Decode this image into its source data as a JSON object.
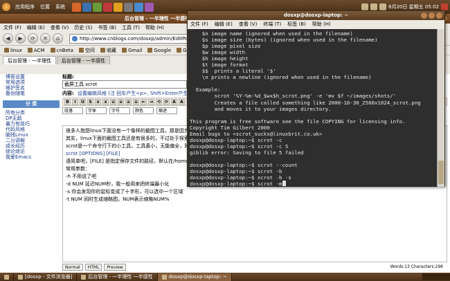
{
  "top_panel": {
    "menu": [
      "应用程序",
      "位置",
      "系统"
    ],
    "clock": "8月20日 星期五 05:02"
  },
  "browser": {
    "title": "后台管理 - 一半理性 一半感性 - 博客园 - Mozilla Firefox",
    "menu": [
      "文件 (F)",
      "编辑 (E)",
      "查看 (V)",
      "历史 (S)",
      "书签 (B)",
      "工具 (T)",
      "帮助 (H)"
    ],
    "url": "http://www.cnblogs.com/dosxp/admin/EditPosts.a",
    "bookmarks": [
      "linux",
      "ACM",
      "cnBeta",
      "空间",
      "收藏",
      "Gmail",
      "Google",
      "GoogleM"
    ],
    "tabs": [
      "后台管理 - 一半理性",
      "后台管理 - 一半感性"
    ],
    "status": "完成"
  },
  "left_col": {
    "top_links": [
      "博客设置",
      "常用选项",
      "维护签名",
      "备份随笔"
    ],
    "category_header": "分 类",
    "links": [
      "所有分类",
      "DP无敌",
      "暴力有技巧",
      "代码风格",
      "脑残Linux",
      "二分讲解",
      "成长经历",
      "综论综论",
      "我爱Emacs"
    ]
  },
  "editor": {
    "title_label": "标题:",
    "title_value": "截屏工具 scrot",
    "content_label": "内容:",
    "content_tools": "设置编辑风格 (注 回车产生<p>, Shift+Enter产生<br>)",
    "toolbar": [
      "B",
      "I",
      "U",
      "S",
      "x",
      "x",
      "≡",
      "≡",
      "≡",
      "≡",
      "⇤",
      "⇥",
      "⟲",
      "⟳",
      "A",
      "A"
    ],
    "selects": [
      "段落",
      "字体",
      "字号",
      "颜色",
      "缩进"
    ],
    "lines": [
      "很多人抱怨linux下面没有一个像样的截图工具，那是因为你没有发现。",
      "其实，linux下面的截图工具还是有很多的，不过处于探索中。",
      "scrot是一个命令行下的小工具，工具虽小，无能偏全，简单实用。",
      "scrot [OPTIONS] [FILE]",
      "语简单吧，[FILE] 是指定保存文件的路径，默认在/home目录下。",
      "常用参数：",
      "-h          不用说了吧",
      "-d NUM      延迟NUM秒，我一般用来把终端最小化",
      "-s          你会发现你的鼠标变成了十字形，可以选中一个区域",
      "-t NUM      同时生成缩略图，NUM表示缩略NUM%"
    ],
    "footer_modes": [
      "Normal",
      "HTML",
      "Preview"
    ],
    "word_count": "Words:13 Characters:296"
  },
  "terminal": {
    "title": "dosxp@dosxp-laptop: ~",
    "menu": [
      "文件 (F)",
      "编辑 (E)",
      "查看 (V)",
      "终端 (T)",
      "标签 (B)",
      "帮助 (H)"
    ],
    "text": "    $n image name (ignored when used in the filename)\n    $s image size (bytes) (ignored when used in the filename)\n    $p image pixel size\n    $w image width\n    $h image height\n    $t image format\n    $$  prints a literal '$'\n    \\n prints a newline (ignored when used in the filename)\n\n  Example:\n        scrot '%Y-%m-%d_$wx$h_scrot.png' -e 'mv $f ~/images/shots/'\n        Creates a file called something like 2000-10-30_2560x1024_scrot.png\n        and moves it to your images directory.\n\nThis program is free software see the file COPYING for licensing info.\nCopyright Tim Gilbert 2000\nEmail bugs to <scrot_sucks@linuxbrit.co.uk>\ndosxp@dosxp-laptop:~$ scrot -c\ndosxp@dosxp-laptop:~$ scrot -c 5\ngiblib error: Saving to file 5 failed\n\ndosxp@dosxp-laptop:~$ scrot --count\ndosxp@dosxp-laptop:~$ scrot -b\ndosxp@dosxp-laptop:~$ scrot -b -s\ndosxp@dosxp-laptop:~$ scrot -m"
  },
  "taskbar": {
    "tasks": [
      "[dosxp - 文件浏览器]",
      "后台管理 - 一半理性 一半感性",
      "dosxp@dosxp-laptop: ~"
    ]
  }
}
